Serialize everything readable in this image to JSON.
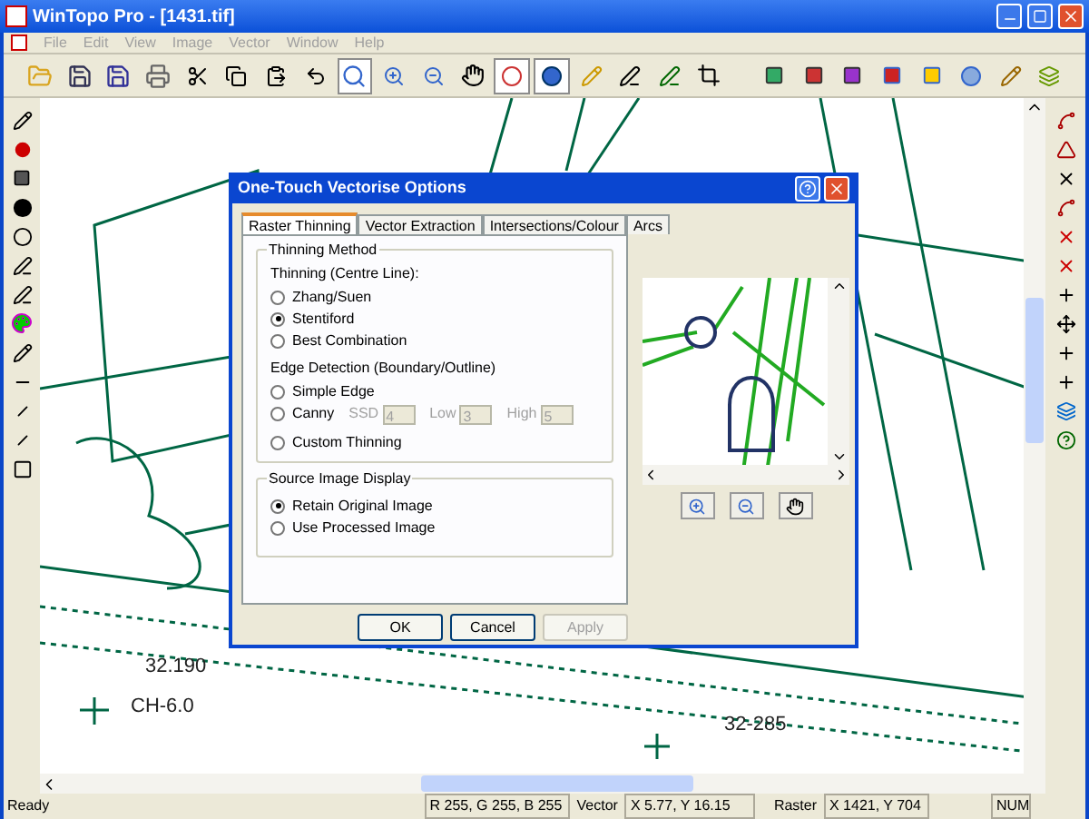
{
  "window": {
    "title": "WinTopo Pro - [1431.tif]"
  },
  "menu": [
    {
      "label": "File",
      "disabled": true
    },
    {
      "label": "Edit",
      "disabled": true
    },
    {
      "label": "View",
      "disabled": true
    },
    {
      "label": "Image",
      "disabled": true
    },
    {
      "label": "Vector",
      "disabled": true
    },
    {
      "label": "Window",
      "disabled": true
    },
    {
      "label": "Help",
      "disabled": true
    }
  ],
  "map": {
    "labels": [
      {
        "text": "32.190"
      },
      {
        "text": "CH-6.0"
      },
      {
        "text": "32-285"
      }
    ]
  },
  "dialog": {
    "title": "One-Touch Vectorise Options",
    "tabs": [
      {
        "label": "Raster Thinning",
        "selected": true
      },
      {
        "label": "Vector Extraction",
        "selected": false
      },
      {
        "label": "Intersections/Colour",
        "selected": false
      },
      {
        "label": "Arcs",
        "selected": false
      }
    ],
    "thinning_method": {
      "title": "Thinning Method",
      "centre_line_label": "Thinning (Centre Line):",
      "edge_label": "Edge Detection (Boundary/Outline)",
      "centre_options": [
        {
          "label": "Zhang/Suen",
          "selected": false
        },
        {
          "label": "Stentiford",
          "selected": true
        },
        {
          "label": "Best Combination",
          "selected": false
        }
      ],
      "edge_options": [
        {
          "label": "Simple Edge",
          "selected": false
        },
        {
          "label": "Canny",
          "selected": false,
          "fields": [
            {
              "label": "SSD",
              "value": "4",
              "disabled": true
            },
            {
              "label": "Low",
              "value": "3",
              "disabled": true
            },
            {
              "label": "High",
              "value": "5",
              "disabled": true
            }
          ]
        }
      ],
      "custom": {
        "label": "Custom Thinning",
        "selected": false
      }
    },
    "source_image_display": {
      "title": "Source Image Display",
      "options": [
        {
          "label": "Retain Original Image",
          "selected": true
        },
        {
          "label": "Use Processed Image",
          "selected": false
        }
      ]
    },
    "buttons": [
      {
        "label": "OK",
        "disabled": false
      },
      {
        "label": "Cancel",
        "disabled": false
      },
      {
        "label": "Apply",
        "disabled": true
      }
    ]
  },
  "status_bar": {
    "message": "Ready",
    "rgb": "R 255, G 255, B 255",
    "vector_label": "Vector",
    "vector_coords": "X 5.77, Y 16.15",
    "raster_label": "Raster",
    "raster_coords": "X 1421, Y 704",
    "num": "NUM"
  }
}
